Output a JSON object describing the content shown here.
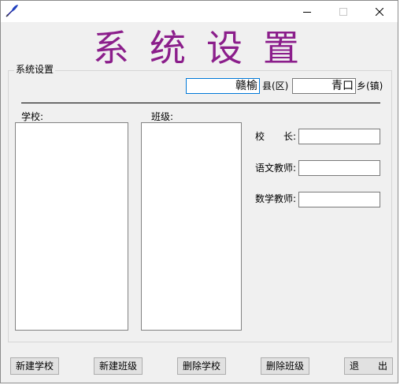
{
  "window": {
    "heading": "系统设置"
  },
  "group": {
    "label": "系统设置"
  },
  "location": {
    "county_value": "赣榆",
    "county_suffix": "县(区)",
    "town_value": "青口",
    "town_suffix": "乡(镇)"
  },
  "lists": {
    "school_label": "学校:",
    "class_label": "班级:"
  },
  "fields": {
    "principal_label": "校　　长:",
    "principal_value": "",
    "chinese_teacher_label": "语文教师:",
    "chinese_teacher_value": "",
    "math_teacher_label": "数学教师:",
    "math_teacher_value": ""
  },
  "buttons": {
    "new_school": "新建学校",
    "new_class": "新建班级",
    "delete_school": "删除学校",
    "delete_class": "删除班级",
    "exit": "退　　出"
  },
  "colors": {
    "heading": "#8b1e8b",
    "window_bg": "#f0f0f0",
    "focus_border": "#0078d7"
  },
  "icons": {
    "app": "feather-icon",
    "minimize": "minimize-icon",
    "maximize": "maximize-icon",
    "close": "close-icon"
  }
}
